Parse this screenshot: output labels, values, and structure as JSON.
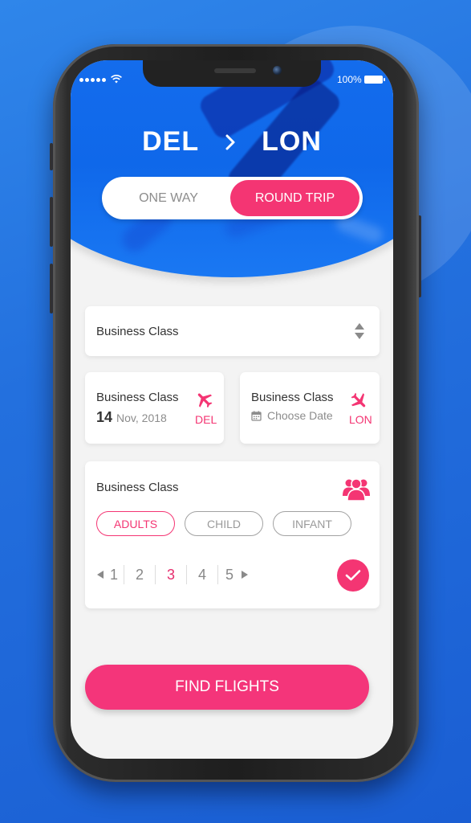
{
  "status_bar": {
    "signal_bars": 5,
    "battery_text": "100%",
    "battery_level_percent": 100
  },
  "route": {
    "origin": "DEL",
    "destination": "LON",
    "separator_icon": "chevron-right-icon"
  },
  "trip_type": {
    "options": [
      "ONE WAY",
      "ROUND TRIP"
    ],
    "selected": "ROUND TRIP"
  },
  "class_select": {
    "value": "Business Class",
    "icon": "sort-updown-icon"
  },
  "departure": {
    "label": "Business Class",
    "day": "14",
    "month_year": "Nov, 2018",
    "city_code": "DEL",
    "icon": "airplane-takeoff-icon"
  },
  "return": {
    "label": "Business Class",
    "placeholder": "Choose Date",
    "city_code": "LON",
    "icon": "airplane-icon",
    "calendar_icon": "calendar-icon"
  },
  "passengers": {
    "label": "Business Class",
    "icon": "group-icon",
    "types": [
      "ADULTS",
      "CHILD",
      "INFANT"
    ],
    "selected_type": "ADULTS",
    "counts": [
      "1",
      "2",
      "3",
      "4",
      "5"
    ],
    "selected_count": "3"
  },
  "actions": {
    "find_flights": "FIND FLIGHTS"
  },
  "colors": {
    "accent": "#f43573",
    "header_blue": "#0f68ea",
    "background_blue": "#2370de"
  }
}
